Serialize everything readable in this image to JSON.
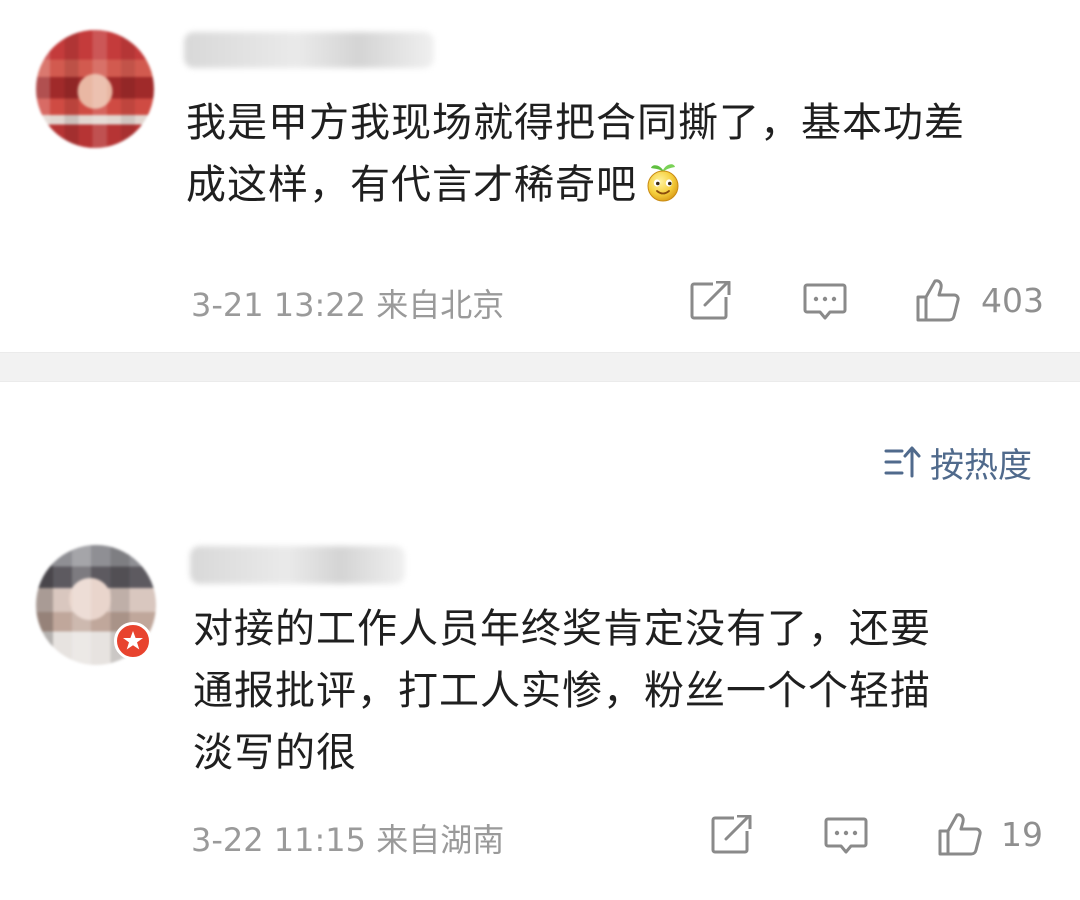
{
  "comments": [
    {
      "text_lines": [
        "我是甲方我现场就得把合同撕了，基本功差",
        "成这样，有代言才稀奇吧"
      ],
      "emoji": "smiling-sprout-emoji",
      "meta": "3-21 13:22 来自北京",
      "likes": "403"
    },
    {
      "text_lines": [
        "对接的工作人员年终奖肯定没有了，还要",
        "通报批评，打工人实惨，粉丝一个个轻描",
        "淡写的很"
      ],
      "meta": "3-22 11:15 来自湖南",
      "likes": "19"
    }
  ],
  "sort": {
    "label": "按热度",
    "icon": "sort-icon"
  },
  "icons": {
    "repost": "share-edit-icon",
    "comment": "comment-icon",
    "like": "thumbs-up-icon"
  },
  "colors": {
    "text": "#1f1f1f",
    "meta": "#9a9a9a",
    "sort_accent": "#506a8c",
    "badge": "#e8432e",
    "divider": "#f2f2f2"
  }
}
